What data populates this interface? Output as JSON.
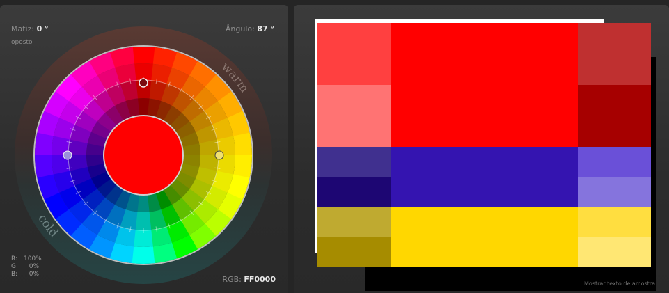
{
  "controls": {
    "hue_label": "Matiz:",
    "hue_value": "0 °",
    "angle_label": "Ângulo:",
    "angle_value": "87 °",
    "opposite_link": "oposto",
    "warm_label": "warm",
    "cold_label": "cold",
    "rgb_r_label": "R:",
    "rgb_r_value": "100%",
    "rgb_g_label": "G:",
    "rgb_g_value": "0%",
    "rgb_b_label": "B:",
    "rgb_b_value": "0%",
    "hex_label": "RGB:",
    "hex_value": "FF0000"
  },
  "palette": {
    "sample_text_link": "Mostrar texto de amostra",
    "base_color": "#FF0000",
    "colors": {
      "red_light_1": "#FF4040",
      "red_light_2": "#FF7373",
      "red_main": "#FF0000",
      "red_dark_1": "#BF3030",
      "red_dark_2": "#A60000",
      "blue_dark_1": "#40308F",
      "blue_dark_2": "#1D0673",
      "blue_main": "#3414B0",
      "blue_light_1": "#6A50D8",
      "blue_light_2": "#8574DD",
      "yellow_dark_1": "#BFAA30",
      "yellow_dark_2": "#A68C00",
      "yellow_main": "#FFD700",
      "yellow_light_1": "#FFDE40",
      "yellow_light_2": "#FFE773"
    }
  }
}
